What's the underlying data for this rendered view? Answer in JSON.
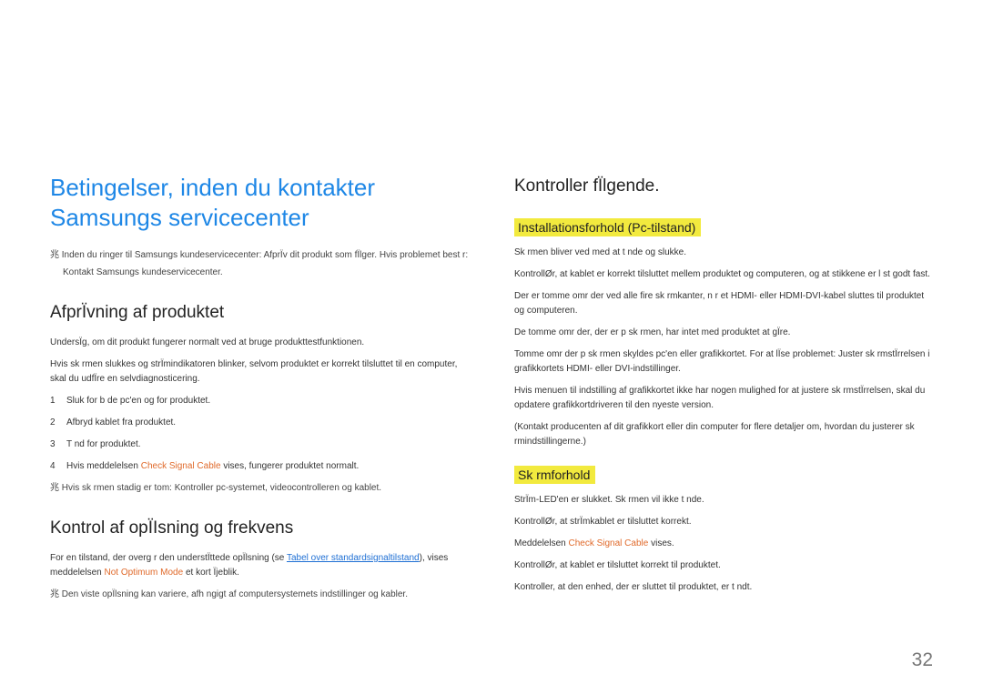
{
  "left": {
    "title": "Betingelser, inden du kontakter Samsungs servicecenter",
    "note1a": "Inden du ringer til Samsungs kundeservicecenter: AfprÏv dit produkt som fÏlger. Hvis problemet best r:",
    "note1b": "Kontakt Samsungs kundeservicecenter.",
    "section1": "AfprÏvning af produktet",
    "p1": "UndersÏg, om dit produkt fungerer normalt ved at bruge produkttestfunktionen.",
    "p2": "Hvis sk rmen slukkes og strÏmindikatoren blinker, selvom produktet er korrekt tilsluttet til en computer, skal du udfÏre en selvdiagnosticering.",
    "steps": [
      "Sluk for b de pc'en og for produktet.",
      "Afbryd kablet fra produktet.",
      "T nd for produktet.",
      "Hvis meddelelsen "
    ],
    "step4_orange": "Check Signal Cable",
    "step4_after": " vises, fungerer produktet normalt.",
    "note2": "Hvis sk rmen stadig er tom: Kontroller pc-systemet, videocontrolleren og kablet.",
    "section2": "Kontrol af opÏIsning og frekvens",
    "p3a": "For en tilstand, der overg r den understÏttede opÏlsning (se ",
    "p3_link": "Tabel over standardsignaltilstand",
    "p3b": "), vises meddelelsen ",
    "p3_orange": "Not Optimum Mode",
    "p3c": " et kort Ïjeblik.",
    "note3": "Den viste opÏlsning kan variere, afh ngigt af computersystemets indstillinger og kabler."
  },
  "right": {
    "title": "Kontroller fÏlgende.",
    "sub1": "Installationsforhold (Pc-tilstand)",
    "r1": "Sk rmen bliver ved med at t nde og slukke.",
    "r2": "KontrollØr, at kablet er korrekt tilsluttet mellem produktet og computeren, og at stikkene er l st godt fast.",
    "r3": "Der er tomme omr der ved alle fire sk rmkanter, n r et HDMI- eller HDMI-DVI-kabel sluttes til produktet og computeren.",
    "r4": "De tomme omr der, der er p  sk rmen, har intet med produktet at gÏre.",
    "r5": "Tomme omr der p  sk rmen skyldes pc'en eller grafikkortet. For at lÏse problemet: Juster sk rmstÏrrelsen i grafikkortets HDMI- eller DVI-indstillinger.",
    "r6": "Hvis menuen til indstilling af grafikkortet ikke har nogen mulighed for at justere sk rmstÏrrelsen, skal du opdatere grafikkortdriveren til den nyeste version.",
    "r7": "(Kontakt producenten af dit grafikkort eller din computer for flere detaljer om, hvordan du justerer sk rmindstillingerne.)",
    "sub2": "Sk rmforhold",
    "s1": "StrÏm-LED'en er slukket. Sk rmen vil ikke t nde.",
    "s2": "KontrollØr, at strÏmkablet er tilsluttet korrekt.",
    "s3a": "Meddelelsen ",
    "s3_orange": "Check Signal Cable",
    "s3b": " vises.",
    "s4": "KontrollØr, at kablet er tilsluttet korrekt til produktet.",
    "s5": "Kontroller, at den enhed, der er sluttet til produktet, er t ndt."
  },
  "symbol": "兆",
  "pagenum": "32"
}
